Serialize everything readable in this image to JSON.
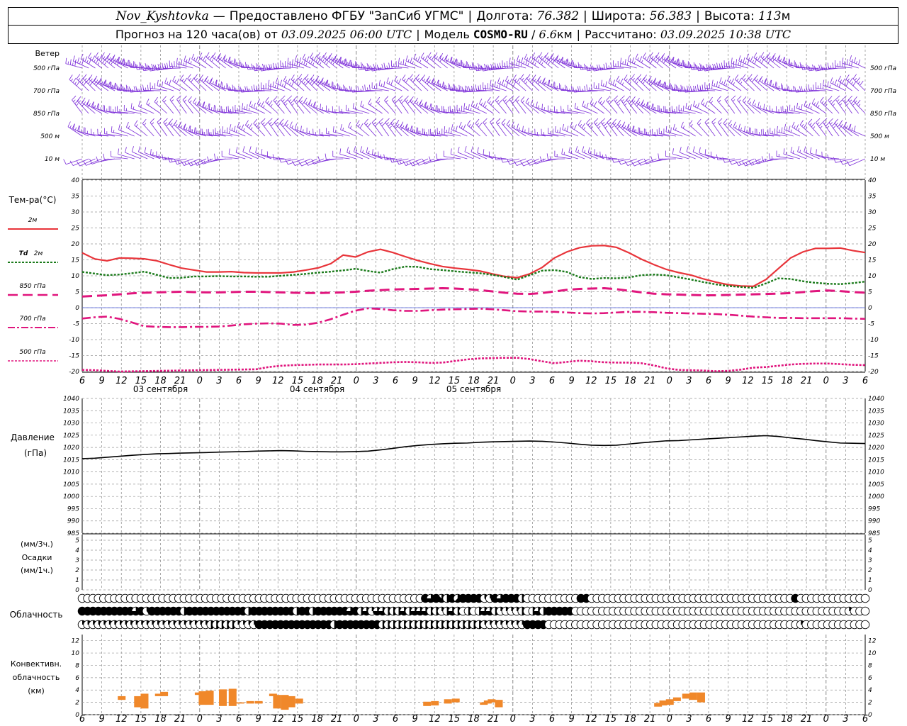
{
  "header": {
    "station": "Nov_Kyshtovka",
    "dash": "—",
    "provider": "Предоставлено ФГБУ \"ЗапСиб УГМС\"",
    "lon_label": "Долгота:",
    "lon": "76.382",
    "lat_label": "Широта:",
    "lat": "56.383",
    "alt_label": "Высота:",
    "alt": "113",
    "alt_unit": "м",
    "forecast_label": "Прогноз на 120 часа(ов)  от",
    "forecast_start": "03.09.2025 06:00 UTC",
    "model_label": "Модель",
    "model": "COSMO-RU",
    "resolution": "6.6",
    "res_unit": "км",
    "calc_label": "Рассчитано:",
    "calc_time": "03.09.2025 10:38 UTC"
  },
  "labels": {
    "wind_title": "Ветер",
    "wind_levels": [
      "500 гПа",
      "700 гПа",
      "850 гПа",
      "500 м",
      "10 м"
    ],
    "temp_title": "Тем-ра(°С)",
    "t2m": "2м",
    "td_prefix": "Td",
    "td_suffix": "2м",
    "t850": "850 гПа",
    "t700": "700 гПа",
    "t500": "500 гПа",
    "pressure_title": "Давление",
    "pressure_unit": "(гПа)",
    "precip_unit3": "(мм/3ч.)",
    "precip_title": "Осадки",
    "precip_unit1": "(мм/1ч.)",
    "cloud_title": "Облачность",
    "conv_title1": "Конвективн.",
    "conv_title2": "облачность",
    "conv_unit": "(км)"
  },
  "chart_data": {
    "type": "line",
    "time_ticks": [
      "6",
      "9",
      "12",
      "15",
      "18",
      "21",
      "0",
      "3",
      "6",
      "9",
      "12",
      "15",
      "18",
      "21",
      "0",
      "3",
      "6",
      "9",
      "12",
      "15",
      "18",
      "21",
      "0",
      "3",
      "6",
      "9",
      "12"
    ],
    "date_labels": [
      "03 сентября",
      "04 сентября",
      "05 сентября"
    ],
    "colors": {
      "t2m": "#e8343a",
      "td2m": "#1a7a1a",
      "isobaric": "#e0157d",
      "wind": "#7a2ad8",
      "pressure": "#000000",
      "conv": "#f0882a",
      "zero": "#4a5ad8"
    },
    "temperature": {
      "ylim": [
        -20,
        40
      ],
      "ticks": [
        40,
        35,
        30,
        25,
        20,
        15,
        10,
        5,
        0,
        -5,
        -10,
        -15,
        -20
      ],
      "series": [
        {
          "name": "2м",
          "key": "t2m",
          "values": [
            17.2,
            15.3,
            14.7,
            15.6,
            15.5,
            15.3,
            14.7,
            13.5,
            12.4,
            11.8,
            11.2,
            11.2,
            11.3,
            11.0,
            10.9,
            10.9,
            10.9,
            11.2,
            11.8,
            12.5,
            13.8,
            16.5,
            15.9,
            17.5,
            18.3,
            17.3,
            16.0,
            14.8,
            13.8,
            12.9,
            12.4,
            12.0,
            11.5,
            10.6,
            9.8,
            9.4,
            10.6,
            12.6,
            15.6,
            17.5,
            18.8,
            19.4,
            19.5,
            18.9,
            17.2,
            15.2,
            13.5,
            12.0,
            11.0,
            10.2,
            9.0,
            8.0,
            7.2,
            6.8,
            6.7,
            8.8,
            12.2,
            15.6,
            17.5,
            18.6,
            18.6,
            18.7,
            17.9,
            17.3
          ]
        },
        {
          "name": "Td 2м",
          "key": "td",
          "values": [
            11.2,
            10.7,
            10.2,
            10.4,
            10.8,
            11.3,
            10.3,
            9.3,
            9.4,
            9.8,
            9.8,
            9.9,
            9.8,
            9.8,
            9.7,
            9.7,
            10.0,
            10.3,
            10.6,
            11.0,
            11.3,
            11.7,
            12.2,
            11.5,
            11.0,
            12.1,
            12.9,
            12.8,
            12.1,
            11.8,
            11.4,
            11.1,
            10.8,
            10.3,
            9.6,
            8.8,
            10.2,
            11.6,
            11.8,
            11.2,
            9.6,
            9.0,
            9.3,
            9.2,
            9.5,
            10.2,
            10.4,
            10.2,
            9.5,
            8.8,
            8.0,
            7.3,
            6.8,
            6.5,
            6.2,
            7.6,
            9.2,
            9.0,
            8.3,
            7.8,
            7.5,
            7.4,
            7.7,
            8.2
          ]
        },
        {
          "name": "850 гПа",
          "key": "t850",
          "values": [
            3.5,
            3.7,
            3.9,
            4.2,
            4.5,
            4.7,
            4.8,
            4.9,
            5.0,
            4.9,
            4.8,
            4.8,
            4.9,
            5.0,
            5.0,
            4.9,
            4.8,
            4.7,
            4.6,
            4.6,
            4.7,
            4.8,
            5.0,
            5.3,
            5.5,
            5.7,
            5.8,
            5.9,
            6.0,
            6.1,
            6.0,
            5.8,
            5.5,
            5.1,
            4.7,
            4.4,
            4.3,
            4.6,
            5.1,
            5.6,
            5.9,
            6.0,
            6.1,
            5.8,
            5.3,
            4.8,
            4.4,
            4.2,
            4.1,
            4.0,
            3.9,
            3.9,
            4.0,
            4.1,
            4.2,
            4.3,
            4.4,
            4.6,
            4.9,
            5.2,
            5.4,
            5.2,
            4.9,
            4.7
          ]
        },
        {
          "name": "700 гПа",
          "key": "t700",
          "values": [
            -3.4,
            -3.0,
            -2.8,
            -3.5,
            -4.6,
            -5.8,
            -6.0,
            -6.1,
            -6.1,
            -6.0,
            -6.0,
            -5.9,
            -5.6,
            -5.2,
            -5.0,
            -4.9,
            -5.0,
            -5.4,
            -5.3,
            -4.7,
            -3.6,
            -2.2,
            -0.9,
            -0.2,
            -0.4,
            -0.8,
            -1.0,
            -1.0,
            -0.8,
            -0.6,
            -0.5,
            -0.4,
            -0.3,
            -0.5,
            -0.8,
            -1.1,
            -1.2,
            -1.2,
            -1.3,
            -1.5,
            -1.7,
            -1.8,
            -1.7,
            -1.5,
            -1.3,
            -1.3,
            -1.4,
            -1.6,
            -1.7,
            -1.8,
            -1.9,
            -2.0,
            -2.2,
            -2.5,
            -2.8,
            -3.0,
            -3.2,
            -3.2,
            -3.3,
            -3.3,
            -3.3,
            -3.3,
            -3.4,
            -3.5
          ]
        },
        {
          "name": "500 гПа",
          "key": "t500",
          "values": [
            -19.5,
            -19.6,
            -19.8,
            -20.0,
            -20.3,
            -20.6,
            -20.8,
            -21.0,
            -21.2,
            -21.3,
            -21.4,
            -21.4,
            -21.0,
            -20.2,
            -19.3,
            -18.6,
            -18.2,
            -18.0,
            -17.9,
            -17.8,
            -17.8,
            -17.8,
            -17.7,
            -17.5,
            -17.3,
            -17.1,
            -17.0,
            -17.1,
            -17.3,
            -17.2,
            -16.7,
            -16.2,
            -15.9,
            -15.8,
            -15.7,
            -15.7,
            -16.1,
            -16.8,
            -17.4,
            -17.0,
            -16.6,
            -16.8,
            -17.1,
            -17.2,
            -17.2,
            -17.4,
            -18.1,
            -19.0,
            -19.5,
            -19.6,
            -19.7,
            -19.9,
            -19.8,
            -19.4,
            -18.8,
            -18.6,
            -18.2,
            -17.8,
            -17.6,
            -17.5,
            -17.5,
            -17.7,
            -17.9,
            -18.0
          ]
        }
      ]
    },
    "pressure": {
      "ylim": [
        985,
        1040
      ],
      "ticks": [
        1040,
        1035,
        1030,
        1025,
        1020,
        1015,
        1010,
        1005,
        1000,
        995,
        990,
        985
      ],
      "values": [
        1015.4,
        1015.6,
        1016.0,
        1016.4,
        1016.8,
        1017.1,
        1017.4,
        1017.5,
        1017.7,
        1017.8,
        1017.9,
        1018.1,
        1018.2,
        1018.3,
        1018.5,
        1018.6,
        1018.7,
        1018.6,
        1018.4,
        1018.3,
        1018.2,
        1018.2,
        1018.3,
        1018.5,
        1019.0,
        1019.6,
        1020.3,
        1020.8,
        1021.2,
        1021.5,
        1021.7,
        1021.8,
        1022.1,
        1022.3,
        1022.4,
        1022.5,
        1022.6,
        1022.5,
        1022.2,
        1021.8,
        1021.3,
        1020.9,
        1020.8,
        1020.9,
        1021.4,
        1021.9,
        1022.3,
        1022.7,
        1022.8,
        1023.1,
        1023.4,
        1023.7,
        1024.0,
        1024.3,
        1024.6,
        1024.8,
        1024.5,
        1023.9,
        1023.4,
        1022.8,
        1022.3,
        1021.8,
        1021.7,
        1021.6
      ]
    },
    "precip": {
      "ylim": [
        0,
        5
      ],
      "ticks": [
        5,
        4,
        3,
        2,
        1,
        0
      ],
      "values": []
    },
    "convective_cloud": {
      "ylim": [
        0,
        13
      ],
      "ticks": [
        12,
        10,
        8,
        6,
        4,
        2,
        0
      ],
      "blocks": [
        [
          6.0,
          2.4,
          3.0
        ],
        [
          8.5,
          1.2,
          3.0
        ],
        [
          9.5,
          1.0,
          3.4
        ],
        [
          11.7,
          3.0,
          3.4
        ],
        [
          12.5,
          3.0,
          3.7
        ],
        [
          17.8,
          3.2,
          3.6
        ],
        [
          18.4,
          1.6,
          3.8
        ],
        [
          19.5,
          1.6,
          3.9
        ],
        [
          21.5,
          1.4,
          4.1
        ],
        [
          23.0,
          1.4,
          4.2
        ],
        [
          24.2,
          1.8,
          2.0
        ],
        [
          25.7,
          1.8,
          2.2
        ],
        [
          27.0,
          1.8,
          2.2
        ],
        [
          29.2,
          3.0,
          3.4
        ],
        [
          29.8,
          1.0,
          3.2
        ],
        [
          31.0,
          0.8,
          3.2
        ],
        [
          32.0,
          1.2,
          3.0
        ],
        [
          33.2,
          1.8,
          2.6
        ],
        [
          52.8,
          1.4,
          2.1
        ],
        [
          54.0,
          1.5,
          2.2
        ],
        [
          56.0,
          1.8,
          2.5
        ],
        [
          57.2,
          2.0,
          2.6
        ],
        [
          61.5,
          1.6,
          2.0
        ],
        [
          62.1,
          1.8,
          2.3
        ],
        [
          62.7,
          2.0,
          2.5
        ],
        [
          63.8,
          1.2,
          2.4
        ],
        [
          88.2,
          1.3,
          1.9
        ],
        [
          89.0,
          1.5,
          2.3
        ],
        [
          90.0,
          1.6,
          2.5
        ],
        [
          91.1,
          2.2,
          2.8
        ],
        [
          92.5,
          2.6,
          3.4
        ],
        [
          93.6,
          2.4,
          3.6
        ],
        [
          94.8,
          2.0,
          3.6
        ]
      ]
    },
    "cloudiness": {
      "rows": [
        {
          "name": "upper",
          "values": [
            0,
            0,
            0,
            0,
            0,
            0,
            0,
            0,
            0,
            0,
            0,
            0,
            0,
            0,
            0,
            0,
            0,
            0,
            0,
            0,
            0,
            0,
            0,
            0,
            0,
            0,
            0,
            0,
            0,
            0,
            0,
            0,
            0,
            0,
            0,
            0,
            0,
            0,
            0,
            0,
            0,
            0,
            0,
            0,
            0,
            0,
            0,
            0,
            0,
            0,
            0,
            0,
            0,
            0,
            0,
            0,
            0,
            0,
            0,
            0,
            0,
            0,
            0,
            0,
            8,
            6,
            8,
            7,
            4,
            8,
            5,
            8,
            8,
            8,
            8,
            3,
            2,
            8,
            6,
            8,
            8,
            8,
            4,
            0,
            0,
            0,
            0,
            0,
            0,
            0,
            0,
            0,
            0,
            8,
            8,
            0,
            0,
            0,
            0,
            0,
            0,
            0,
            0,
            0,
            0,
            0,
            0,
            0,
            0,
            0,
            0,
            0,
            0,
            0,
            0,
            0,
            0,
            0,
            0,
            0,
            0,
            0,
            0,
            0,
            0,
            0,
            0,
            0,
            0,
            0,
            0,
            0,
            0,
            8
          ]
        },
        {
          "name": "middle",
          "values": [
            8,
            8,
            8,
            8,
            8,
            8,
            8,
            8,
            8,
            8,
            6,
            8,
            3,
            8,
            8,
            8,
            8,
            8,
            8,
            4,
            8,
            8,
            8,
            8,
            8,
            8,
            8,
            8,
            8,
            8,
            8,
            4,
            8,
            8,
            8,
            8,
            8,
            8,
            8,
            8,
            4,
            8,
            8,
            4,
            8,
            8,
            8,
            8,
            8,
            8,
            6,
            8,
            4,
            6,
            2,
            6,
            6,
            4,
            4,
            4,
            6,
            4,
            6,
            6,
            6,
            4,
            4,
            2,
            4,
            6,
            4,
            0,
            4,
            0,
            4,
            6,
            6,
            4,
            2,
            2,
            2,
            2,
            4,
            0,
            4,
            6,
            4,
            8,
            8,
            8,
            8,
            8,
            0,
            0,
            0,
            0,
            0,
            0,
            0,
            0,
            0,
            0,
            0,
            0,
            0,
            0,
            0,
            0,
            0,
            0,
            0,
            0,
            0,
            0,
            0,
            0,
            0,
            0,
            0,
            0,
            0,
            0,
            0,
            0,
            0,
            0,
            0,
            0,
            0,
            0,
            0,
            0,
            0,
            0,
            0,
            0,
            0,
            0,
            0,
            0,
            0,
            0,
            0,
            2
          ]
        },
        {
          "name": "lower",
          "values": [
            2,
            2,
            2,
            2,
            2,
            2,
            2,
            2,
            2,
            2,
            2,
            2,
            2,
            2,
            2,
            2,
            2,
            2,
            2,
            2,
            2,
            2,
            2,
            2,
            4,
            4,
            4,
            4,
            4,
            2,
            2,
            2,
            2,
            8,
            8,
            8,
            8,
            8,
            8,
            8,
            8,
            8,
            8,
            8,
            8,
            8,
            8,
            4,
            8,
            8,
            8,
            8,
            8,
            8,
            8,
            8,
            4,
            4,
            4,
            4,
            4,
            4,
            4,
            4,
            4,
            4,
            4,
            4,
            4,
            4,
            4,
            4,
            4,
            4,
            4,
            2,
            2,
            2,
            2,
            2,
            2,
            2,
            2,
            8,
            8,
            8,
            8,
            0,
            0,
            0,
            0,
            0,
            0,
            0,
            0,
            0,
            0,
            0,
            0,
            0,
            0,
            0,
            0,
            0,
            0,
            0,
            0,
            0,
            0,
            0,
            0,
            0,
            0,
            0,
            0,
            0,
            0,
            0,
            0,
            0,
            0,
            0,
            0,
            0,
            0,
            0,
            0,
            0,
            0,
            0,
            0,
            0,
            0,
            0,
            2,
            0,
            0,
            0,
            0,
            0,
            0,
            0,
            0,
            0,
            0,
            0,
            0,
            0,
            0,
            0,
            0,
            0,
            0,
            0,
            0,
            0,
            0,
            0,
            0,
            0,
            0,
            0,
            0,
            0,
            0,
            0,
            0,
            0,
            0,
            0,
            0,
            4
          ]
        }
      ]
    },
    "wind": {
      "levels": [
        "500 гПа",
        "700 гПа",
        "850 гПа",
        "500 м",
        "10 м"
      ],
      "rows": [
        {
          "name": "500 гПа",
          "dir": 285,
          "speed_kt": 25
        },
        {
          "name": "700 гПа",
          "dir": 290,
          "speed_kt": 20
        },
        {
          "name": "850 гПа",
          "dir": 300,
          "speed_kt": 15
        },
        {
          "name": "500 м",
          "dir": 300,
          "speed_kt": 15
        },
        {
          "name": "10 м",
          "dir": 270,
          "speed_kt": 5
        }
      ]
    }
  }
}
